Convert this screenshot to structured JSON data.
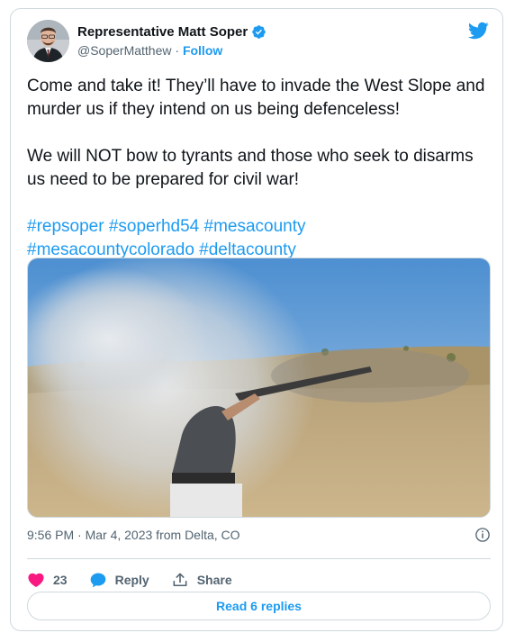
{
  "author": {
    "name": "Representative Matt Soper",
    "handle": "@SoperMatthew",
    "separator": "·",
    "follow_label": "Follow"
  },
  "tweet": {
    "paragraph1": "Come and take it! They’ll have to invade the West Slope and murder us if they intend on us being defenceless!",
    "paragraph2": "We will NOT bow to tyrants and those who seek to disarms us need to be prepared for civil war!",
    "hashtags_line1": [
      "#repsoper",
      "#soperhd54",
      "#mesacounty"
    ],
    "hashtags_line2": [
      "#mesacountycolorado",
      "#deltacounty"
    ]
  },
  "meta": {
    "timestamp": "9:56 PM · Mar 4, 2023 from Delta, CO"
  },
  "actions": {
    "like_count": "23",
    "reply_label": "Reply",
    "share_label": "Share"
  },
  "read_replies_label": "Read 6 replies",
  "colors": {
    "accent": "#1d9bf0",
    "like": "#f91880",
    "text": "#0f1419",
    "muted": "#536471",
    "border": "#cfd9de"
  },
  "icons": [
    "verified-badge-icon",
    "twitter-bird-icon",
    "info-icon",
    "heart-icon",
    "reply-bubble-icon",
    "share-icon"
  ]
}
